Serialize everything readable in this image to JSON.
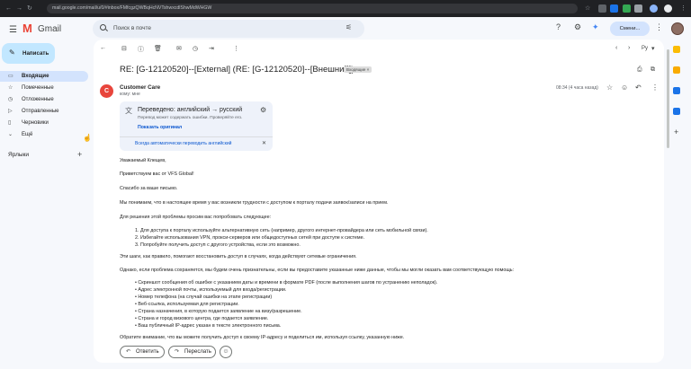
{
  "browser": {
    "url": "mail.google.com/mail/u/0/#inbox/FMfcgzQWBqHcNVTshwxcdlShwMdWHGW"
  },
  "header": {
    "logo_text": "Gmail",
    "search_placeholder": "Поиск в почте",
    "company_chip": "Смени..."
  },
  "sidebar": {
    "compose_label": "Написать",
    "items": [
      {
        "label": "Входящие",
        "icon": "inbox-icon"
      },
      {
        "label": "Помеченные",
        "icon": "star-icon"
      },
      {
        "label": "Отложенные",
        "icon": "clock-icon"
      },
      {
        "label": "Отправленные",
        "icon": "send-icon"
      },
      {
        "label": "Черновики",
        "icon": "draft-icon"
      },
      {
        "label": "Ещё",
        "icon": "chevron-down-icon"
      }
    ],
    "labels_heading": "Ярлыки"
  },
  "toolbar": {
    "lang": "Ру"
  },
  "email": {
    "subject": "RE: [G-12120520]--[External] (RE: [G-12120520]--[Внешний])",
    "folder_badge": "Входящие ×",
    "sender": "Customer Care",
    "sender_initial": "C",
    "to": "кому: мне",
    "time": "08:34 (4 часа назад)",
    "translate": {
      "title": "Переведено: английский → русский",
      "subtitle": "Перевод может содержать ошибки. Проверяйте его.",
      "show_original": "Показать оригинал",
      "always": "Всегда автоматически переводить английский"
    },
    "paragraphs": [
      "Уважаемый Клещев,",
      "Приветствуем вас от VFS Global!",
      "Спасибо за ваше письмо.",
      "Мы понимаем, что в настоящее время у вас возникли трудности с доступом к порталу подачи заявок/записи на прием.",
      "Для решения этой проблемы просим вас попробовать следующее:"
    ],
    "steps": [
      "1. Для доступа к порталу используйте альтернативную сеть (например, другого интернет-провайдера или сеть мобильной связи).",
      "2. Избегайте использования VPN, прокси-серверов или общедоступных сетей при доступе к системе.",
      "3. Попробуйте получить доступ с другого устройства, если это возможно."
    ],
    "note": "Эти шаги, как правило, помогают восстановить доступ в случаях, когда действуют сетевые ограничения.",
    "request": "Однако, если проблема сохраняется, мы будем очень признательны, если вы предоставите указанные ниже данные, чтобы мы могли оказать вам соответствующую помощь:",
    "bullets": [
      "Скриншот сообщения об ошибке с указанием даты и времени в формате PDF (после выполнения шагов по устранению неполадок).",
      "Адрес электронной почты, используемый для входа/регистрации.",
      "Номер телефона (на случай ошибки на этапе регистрации)",
      "Веб-ссылка, используемая для регистрации.",
      "Страна назначения, в которую подается заявление на визу/разрешение.",
      "Страна и город визового центра, где подается заявление.",
      "Ваш публичный IP-адрес указан в тексте электронного письма."
    ],
    "last_line": "Обратите внимание, что вы можете получить доступ к своему IP-адресу и поделиться им, используя ссылку, указанную ниже."
  },
  "reply": {
    "reply_label": "Ответить",
    "forward_label": "Переслать"
  }
}
